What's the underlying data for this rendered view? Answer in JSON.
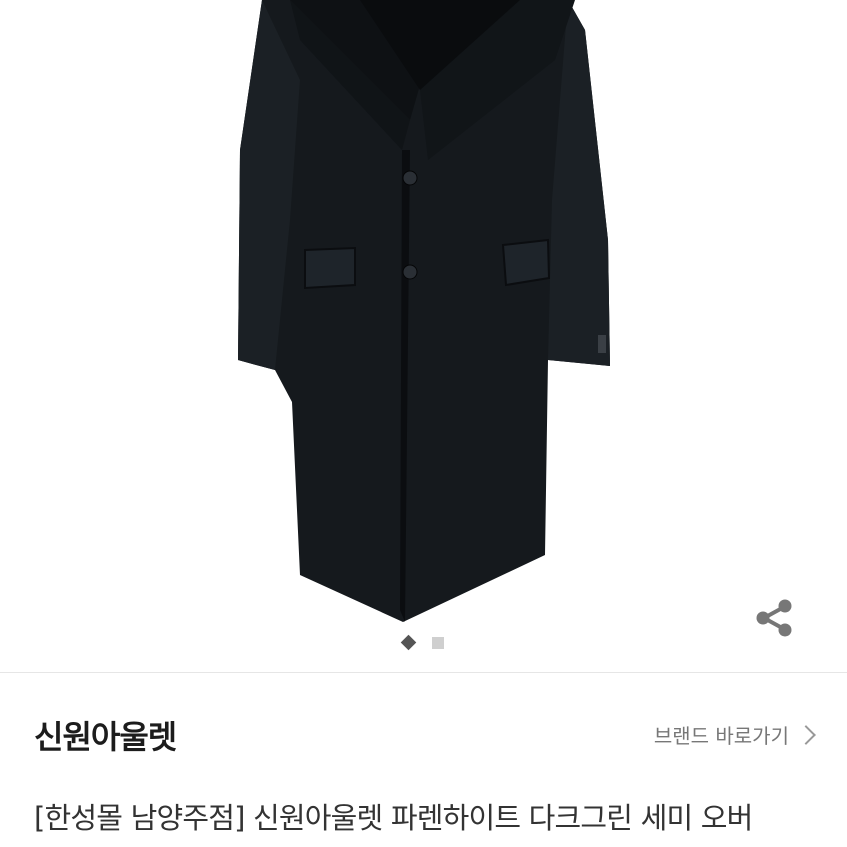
{
  "product": {
    "image_alt": "dark green semi overcoat",
    "carousel": {
      "current_page": 1,
      "total_pages": 2
    }
  },
  "icons": {
    "share": "share-icon",
    "chevron": "chevron-right-icon"
  },
  "brand": {
    "name": "신원아울렛",
    "link_label": "브랜드 바로가기"
  },
  "title": "[한성몰 남양주점] 신원아울렛 파렌하이트 다크그린 세미 오버",
  "colors": {
    "coat": "#15191d",
    "share_icon": "#777777",
    "pager_active": "#555555",
    "pager_inactive": "#cfcfcf"
  }
}
